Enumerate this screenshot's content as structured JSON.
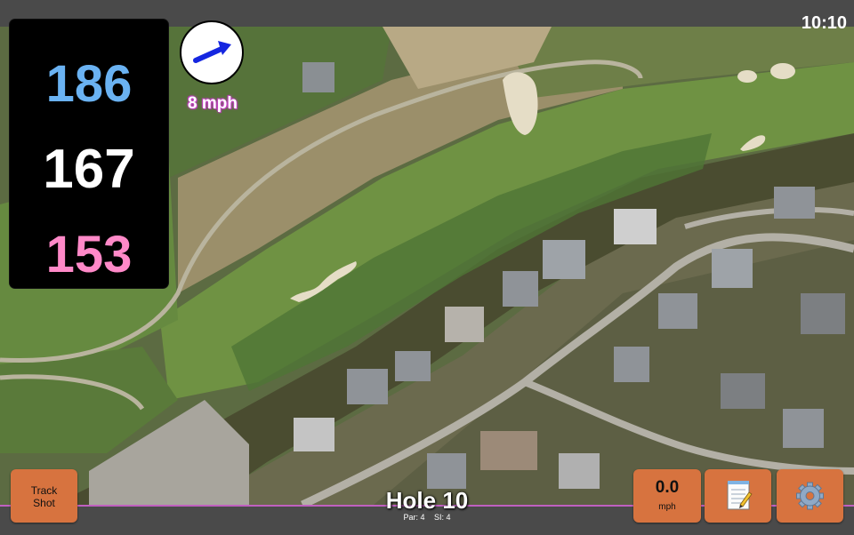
{
  "status": {
    "time": "10:10"
  },
  "distances": {
    "back": "186",
    "middle": "167",
    "front": "153"
  },
  "wind": {
    "speed_label": "8 mph",
    "direction_icon": "wind-arrow-icon"
  },
  "hole": {
    "title": "Hole 10",
    "par": "Par: 4",
    "si": "SI: 4"
  },
  "buttons": {
    "track_shot_line1": "Track",
    "track_shot_line2": "Shot",
    "wind_value": "0.0",
    "wind_unit": "mph",
    "notes_icon": "notepad-icon",
    "settings_icon": "gear-icon"
  },
  "colors": {
    "back": "#6ab2f2",
    "middle": "#ffffff",
    "front": "#ff89c8",
    "button": "#d7733f",
    "accent_border": "#c060c0"
  }
}
